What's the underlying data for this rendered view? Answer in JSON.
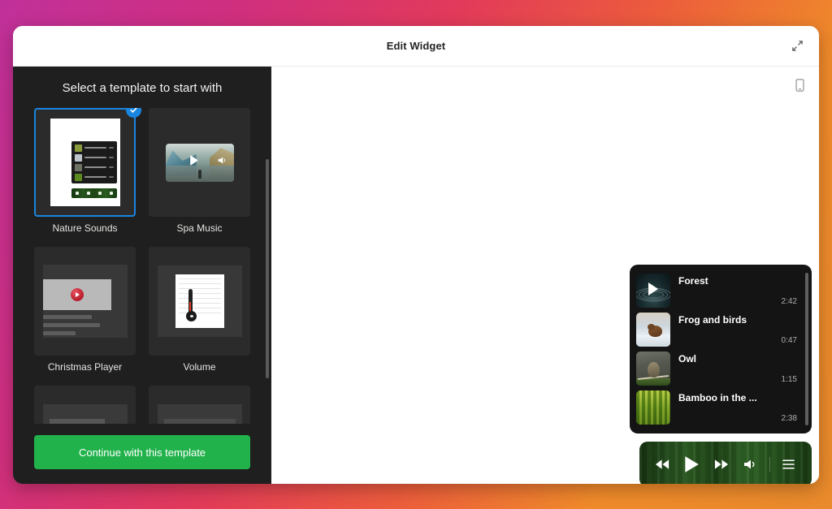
{
  "header": {
    "title": "Edit Widget",
    "expand_icon": "expand-arrows-icon"
  },
  "canvas": {
    "device_toggle_icon": "mobile-device-icon"
  },
  "sidebar": {
    "title": "Select a template to start with",
    "continue_label": "Continue with this template",
    "accent_selected": "#1a86e0",
    "accent_button": "#22b24c",
    "templates": [
      {
        "label": "Nature Sounds",
        "selected": true,
        "preview": "playlist-widget-preview"
      },
      {
        "label": "Spa Music",
        "selected": false,
        "preview": "video-player-preview"
      },
      {
        "label": "Christmas Player",
        "selected": false,
        "preview": "video-article-preview"
      },
      {
        "label": "Volume",
        "selected": false,
        "preview": "thermometer-document-preview"
      }
    ]
  },
  "widget": {
    "background": "#141414",
    "tracks": [
      {
        "title": "Forest",
        "duration": "2:42",
        "art": "water-ripple-art",
        "playing": true
      },
      {
        "title": "Frog and birds",
        "duration": "0:47",
        "art": "frog-snow-art",
        "playing": false
      },
      {
        "title": "Owl",
        "duration": "1:15",
        "art": "owl-branch-art",
        "playing": false
      },
      {
        "title": "Bamboo in the ...",
        "duration": "2:38",
        "art": "bamboo-grove-art",
        "playing": false
      }
    ],
    "controls": [
      {
        "name": "rewind-button",
        "icon": "rewind-icon"
      },
      {
        "name": "play-button",
        "icon": "play-icon"
      },
      {
        "name": "fast-forward-button",
        "icon": "fast-forward-icon"
      },
      {
        "name": "volume-button",
        "icon": "speaker-icon"
      },
      {
        "name": "playlist-button",
        "icon": "list-icon"
      }
    ]
  }
}
